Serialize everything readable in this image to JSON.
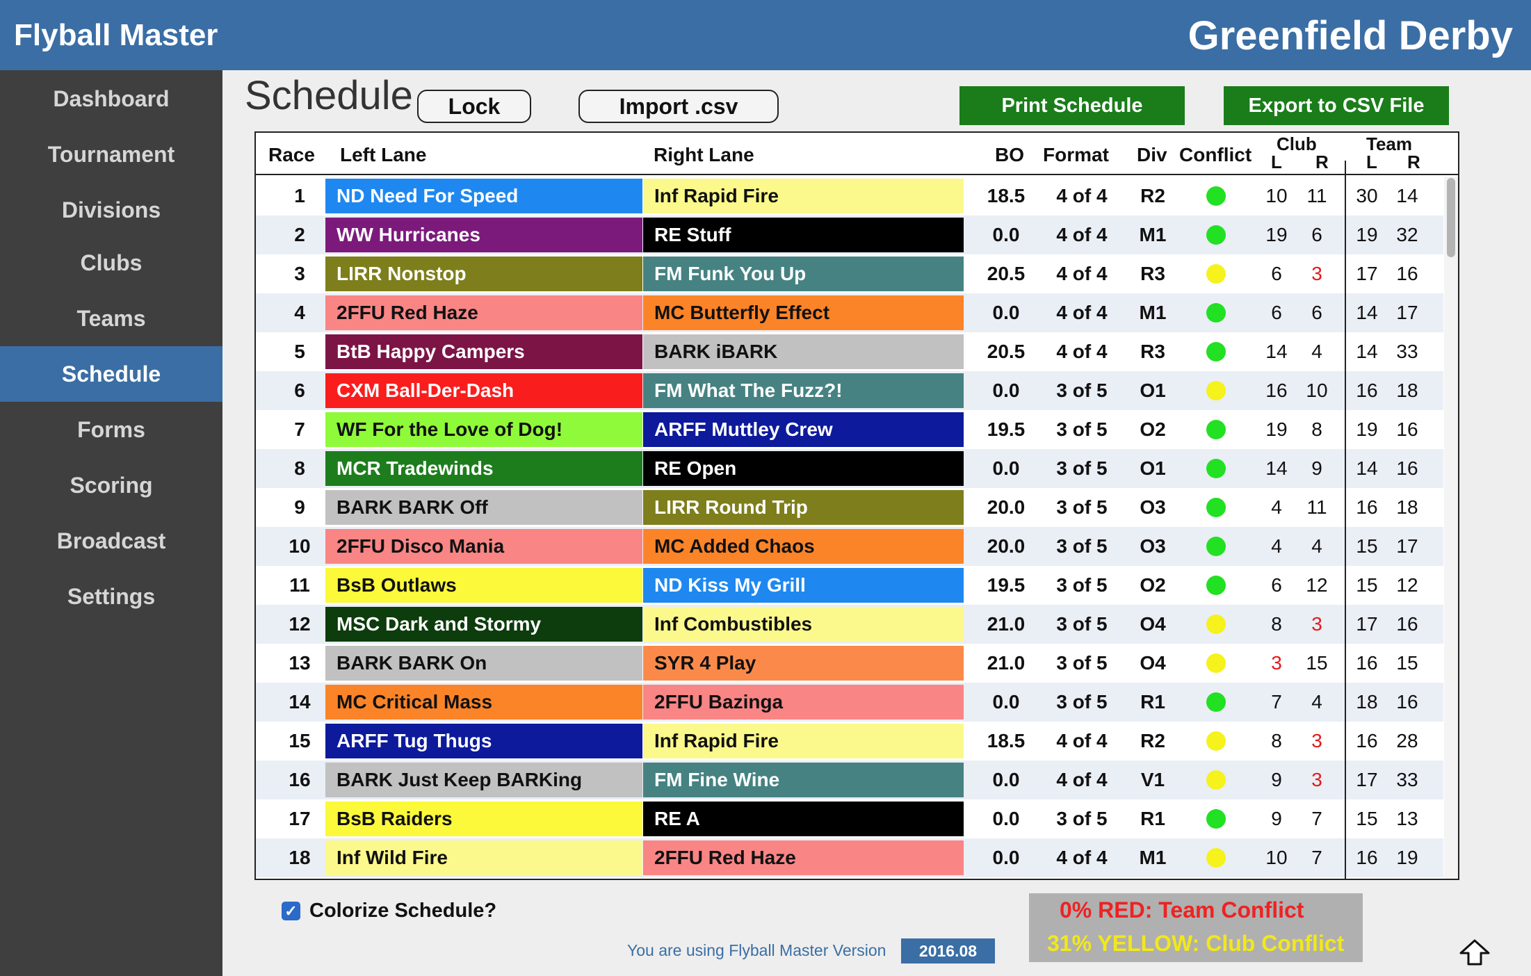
{
  "app": {
    "title": "Flyball Master",
    "event_title": "Greenfield Derby"
  },
  "sidebar": {
    "items": [
      {
        "label": "Dashboard"
      },
      {
        "label": "Tournament"
      },
      {
        "label": "Divisions"
      },
      {
        "label": "Clubs"
      },
      {
        "label": "Teams"
      },
      {
        "label": "Schedule",
        "active": true
      },
      {
        "label": "Forms"
      },
      {
        "label": "Scoring"
      },
      {
        "label": "Broadcast"
      },
      {
        "label": "Settings"
      }
    ]
  },
  "page": {
    "title": "Schedule",
    "lock_label": "Lock",
    "import_label": "Import .csv",
    "print_label": "Print Schedule",
    "export_label": "Export to CSV File"
  },
  "table": {
    "headers": {
      "race": "Race",
      "left": "Left Lane",
      "right": "Right Lane",
      "bo": "BO",
      "format": "Format",
      "div": "Div",
      "conflict": "Conflict",
      "club": "Club",
      "team": "Team",
      "l": "L",
      "r": "R"
    },
    "rows": [
      {
        "race": "1",
        "left": "ND Need For Speed",
        "left_bg": "#1e88f0",
        "left_fg": "#ffffff",
        "right": "Inf Rapid Fire",
        "right_bg": "#fbf98b",
        "right_fg": "#111111",
        "bo": "18.5",
        "format": "4 of 4",
        "div": "R2",
        "conflict": "green",
        "club_l": "10",
        "club_r": "11",
        "team_l": "30",
        "team_r": "14",
        "red": ""
      },
      {
        "race": "2",
        "left": "WW Hurricanes",
        "left_bg": "#7c1a7c",
        "left_fg": "#ffffff",
        "right": "RE Stuff",
        "right_bg": "#000000",
        "right_fg": "#ffffff",
        "bo": "0.0",
        "format": "4 of 4",
        "div": "M1",
        "conflict": "green",
        "club_l": "19",
        "club_r": "6",
        "team_l": "19",
        "team_r": "32",
        "red": ""
      },
      {
        "race": "3",
        "left": "LIRR Nonstop",
        "left_bg": "#7e7e1c",
        "left_fg": "#ffffff",
        "right": "FM Funk You Up",
        "right_bg": "#468282",
        "right_fg": "#ffffff",
        "bo": "20.5",
        "format": "4 of 4",
        "div": "R3",
        "conflict": "yellow",
        "club_l": "6",
        "club_r": "3",
        "team_l": "17",
        "team_r": "16",
        "red": "club_r"
      },
      {
        "race": "4",
        "left": "2FFU Red Haze",
        "left_bg": "#f98585",
        "left_fg": "#111111",
        "right": "MC Butterfly Effect",
        "right_bg": "#fb8428",
        "right_fg": "#111111",
        "bo": "0.0",
        "format": "4 of 4",
        "div": "M1",
        "conflict": "green",
        "club_l": "6",
        "club_r": "6",
        "team_l": "14",
        "team_r": "17",
        "red": ""
      },
      {
        "race": "5",
        "left": "BtB Happy Campers",
        "left_bg": "#7c1446",
        "left_fg": "#ffffff",
        "right": "BARK iBARK",
        "right_bg": "#c1c1c1",
        "right_fg": "#111111",
        "bo": "20.5",
        "format": "4 of 4",
        "div": "R3",
        "conflict": "green",
        "club_l": "14",
        "club_r": "4",
        "team_l": "14",
        "team_r": "33",
        "red": ""
      },
      {
        "race": "6",
        "left": "CXM Ball-Der-Dash",
        "left_bg": "#fa1d1d",
        "left_fg": "#ffffff",
        "right": "FM What The Fuzz?!",
        "right_bg": "#468282",
        "right_fg": "#ffffff",
        "bo": "0.0",
        "format": "3 of 5",
        "div": "O1",
        "conflict": "yellow",
        "club_l": "16",
        "club_r": "10",
        "team_l": "16",
        "team_r": "18",
        "red": ""
      },
      {
        "race": "7",
        "left": "WF For the Love of Dog!",
        "left_bg": "#8ffa3a",
        "left_fg": "#111111",
        "right": "ARFF Muttley Crew",
        "right_bg": "#0d1a9c",
        "right_fg": "#ffffff",
        "bo": "19.5",
        "format": "3 of 5",
        "div": "O2",
        "conflict": "green",
        "club_l": "19",
        "club_r": "8",
        "team_l": "19",
        "team_r": "16",
        "red": ""
      },
      {
        "race": "8",
        "left": "MCR Tradewinds",
        "left_bg": "#1d7d1d",
        "left_fg": "#ffffff",
        "right": "RE Open",
        "right_bg": "#000000",
        "right_fg": "#ffffff",
        "bo": "0.0",
        "format": "3 of 5",
        "div": "O1",
        "conflict": "green",
        "club_l": "14",
        "club_r": "9",
        "team_l": "14",
        "team_r": "16",
        "red": ""
      },
      {
        "race": "9",
        "left": "BARK BARK Off",
        "left_bg": "#c1c1c1",
        "left_fg": "#111111",
        "right": "LIRR Round Trip",
        "right_bg": "#7e7e1c",
        "right_fg": "#ffffff",
        "bo": "20.0",
        "format": "3 of 5",
        "div": "O3",
        "conflict": "green",
        "club_l": "4",
        "club_r": "11",
        "team_l": "16",
        "team_r": "18",
        "red": ""
      },
      {
        "race": "10",
        "left": "2FFU Disco Mania",
        "left_bg": "#f98585",
        "left_fg": "#111111",
        "right": "MC Added Chaos",
        "right_bg": "#fb8428",
        "right_fg": "#111111",
        "bo": "20.0",
        "format": "3 of 5",
        "div": "O3",
        "conflict": "green",
        "club_l": "4",
        "club_r": "4",
        "team_l": "15",
        "team_r": "17",
        "red": ""
      },
      {
        "race": "11",
        "left": "BsB Outlaws",
        "left_bg": "#fbf93a",
        "left_fg": "#111111",
        "right": "ND Kiss My Grill",
        "right_bg": "#1e88f0",
        "right_fg": "#ffffff",
        "bo": "19.5",
        "format": "3 of 5",
        "div": "O2",
        "conflict": "green",
        "club_l": "6",
        "club_r": "12",
        "team_l": "15",
        "team_r": "12",
        "red": ""
      },
      {
        "race": "12",
        "left": "MSC Dark and Stormy",
        "left_bg": "#0d3c0d",
        "left_fg": "#ffffff",
        "right": "Inf Combustibles",
        "right_bg": "#fbf98b",
        "right_fg": "#111111",
        "bo": "21.0",
        "format": "3 of 5",
        "div": "O4",
        "conflict": "yellow",
        "club_l": "8",
        "club_r": "3",
        "team_l": "17",
        "team_r": "16",
        "red": "club_r"
      },
      {
        "race": "13",
        "left": "BARK BARK On",
        "left_bg": "#c1c1c1",
        "left_fg": "#111111",
        "right": "SYR 4 Play",
        "right_bg": "#fb8a4a",
        "right_fg": "#111111",
        "bo": "21.0",
        "format": "3 of 5",
        "div": "O4",
        "conflict": "yellow",
        "club_l": "3",
        "club_r": "15",
        "team_l": "16",
        "team_r": "15",
        "red": "club_l"
      },
      {
        "race": "14",
        "left": "MC Critical Mass",
        "left_bg": "#fb8428",
        "left_fg": "#111111",
        "right": "2FFU Bazinga",
        "right_bg": "#f98585",
        "right_fg": "#111111",
        "bo": "0.0",
        "format": "3 of 5",
        "div": "R1",
        "conflict": "green",
        "club_l": "7",
        "club_r": "4",
        "team_l": "18",
        "team_r": "16",
        "red": ""
      },
      {
        "race": "15",
        "left": "ARFF Tug Thugs",
        "left_bg": "#0d1a9c",
        "left_fg": "#ffffff",
        "right": "Inf Rapid Fire",
        "right_bg": "#fbf98b",
        "right_fg": "#111111",
        "bo": "18.5",
        "format": "4 of 4",
        "div": "R2",
        "conflict": "yellow",
        "club_l": "8",
        "club_r": "3",
        "team_l": "16",
        "team_r": "28",
        "red": "club_r"
      },
      {
        "race": "16",
        "left": "BARK Just Keep BARKing",
        "left_bg": "#c1c1c1",
        "left_fg": "#111111",
        "right": "FM Fine Wine",
        "right_bg": "#468282",
        "right_fg": "#ffffff",
        "bo": "0.0",
        "format": "4 of 4",
        "div": "V1",
        "conflict": "yellow",
        "club_l": "9",
        "club_r": "3",
        "team_l": "17",
        "team_r": "33",
        "red": "club_r"
      },
      {
        "race": "17",
        "left": "BsB Raiders",
        "left_bg": "#fbf93a",
        "left_fg": "#111111",
        "right": "RE A",
        "right_bg": "#000000",
        "right_fg": "#ffffff",
        "bo": "0.0",
        "format": "3 of 5",
        "div": "R1",
        "conflict": "green",
        "club_l": "9",
        "club_r": "7",
        "team_l": "15",
        "team_r": "13",
        "red": ""
      },
      {
        "race": "18",
        "left": "Inf Wild Fire",
        "left_bg": "#fbf98b",
        "left_fg": "#111111",
        "right": "2FFU Red Haze",
        "right_bg": "#f98585",
        "right_fg": "#111111",
        "bo": "0.0",
        "format": "4 of 4",
        "div": "M1",
        "conflict": "yellow",
        "club_l": "10",
        "club_r": "7",
        "team_l": "16",
        "team_r": "19",
        "red": ""
      }
    ]
  },
  "footer": {
    "colorize_label": "Colorize Schedule?",
    "colorize_checked": true,
    "version_text": "You are using Flyball Master Version",
    "version": "2016.08",
    "stat_red": "0% RED: Team Conflict",
    "stat_yellow": "31% YELLOW: Club Conflict"
  },
  "icons": {
    "checkbox": "checkmark-icon",
    "scroll_top": "up-arrow-icon"
  },
  "colors": {
    "brand_blue": "#3a6ea5",
    "sidebar": "#3f3f3f",
    "action_green": "#1a7d1a",
    "conflict_green": "#22e022",
    "conflict_yellow": "#f5f21c",
    "alert_red": "#e31b1b"
  }
}
